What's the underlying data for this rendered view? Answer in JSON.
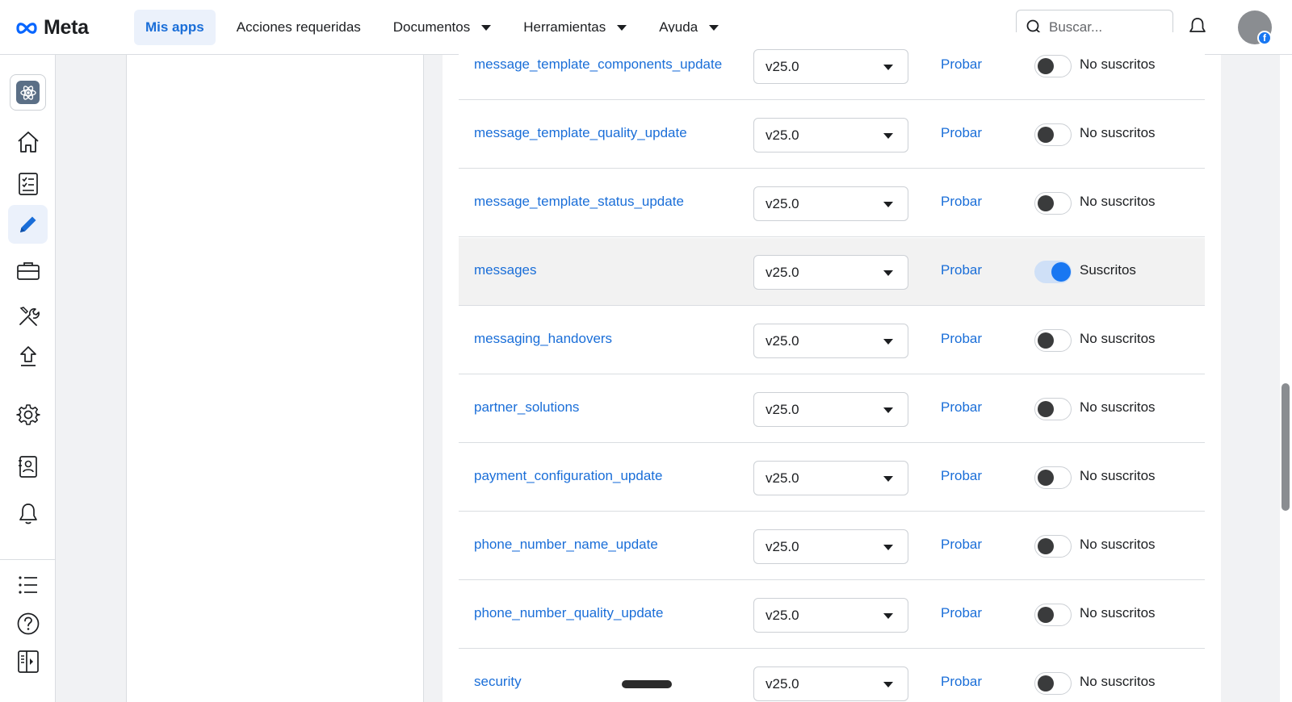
{
  "brand": {
    "name": "Meta",
    "logo_icon": "meta-infinity-logo"
  },
  "nav": {
    "items": [
      {
        "label": "Mis apps",
        "active": true,
        "dropdown": false
      },
      {
        "label": "Acciones requeridas",
        "active": false,
        "dropdown": false
      },
      {
        "label": "Documentos",
        "active": false,
        "dropdown": true
      },
      {
        "label": "Herramientas",
        "active": false,
        "dropdown": true
      },
      {
        "label": "Ayuda",
        "active": false,
        "dropdown": true
      }
    ]
  },
  "search": {
    "placeholder": "Buscar..."
  },
  "rail": {
    "icons": [
      "app-icon",
      "home-icon",
      "checklist-icon",
      "pencil-icon",
      "briefcase-icon",
      "tools-icon",
      "upload-icon",
      "gear-icon",
      "contacts-icon",
      "bell-icon",
      "list-icon",
      "help-icon",
      "sidebar-toggle-icon"
    ],
    "active": "pencil-icon"
  },
  "webhook_fields": [
    {
      "name": "message_template_components_update",
      "version": "v25.0",
      "test_label": "Probar",
      "subscribed": false,
      "status": "No suscritos"
    },
    {
      "name": "message_template_quality_update",
      "version": "v25.0",
      "test_label": "Probar",
      "subscribed": false,
      "status": "No suscritos"
    },
    {
      "name": "message_template_status_update",
      "version": "v25.0",
      "test_label": "Probar",
      "subscribed": false,
      "status": "No suscritos"
    },
    {
      "name": "messages",
      "version": "v25.0",
      "test_label": "Probar",
      "subscribed": true,
      "status": "Suscritos"
    },
    {
      "name": "messaging_handovers",
      "version": "v25.0",
      "test_label": "Probar",
      "subscribed": false,
      "status": "No suscritos"
    },
    {
      "name": "partner_solutions",
      "version": "v25.0",
      "test_label": "Probar",
      "subscribed": false,
      "status": "No suscritos"
    },
    {
      "name": "payment_configuration_update",
      "version": "v25.0",
      "test_label": "Probar",
      "subscribed": false,
      "status": "No suscritos"
    },
    {
      "name": "phone_number_name_update",
      "version": "v25.0",
      "test_label": "Probar",
      "subscribed": false,
      "status": "No suscritos"
    },
    {
      "name": "phone_number_quality_update",
      "version": "v25.0",
      "test_label": "Probar",
      "subscribed": false,
      "status": "No suscritos"
    },
    {
      "name": "security",
      "version": "v25.0",
      "test_label": "Probar",
      "subscribed": false,
      "status": "No suscritos"
    }
  ],
  "colors": {
    "link": "#1a6ed8",
    "toggle_on": "#1877f2",
    "nav_active_bg": "#ebf1fb"
  }
}
